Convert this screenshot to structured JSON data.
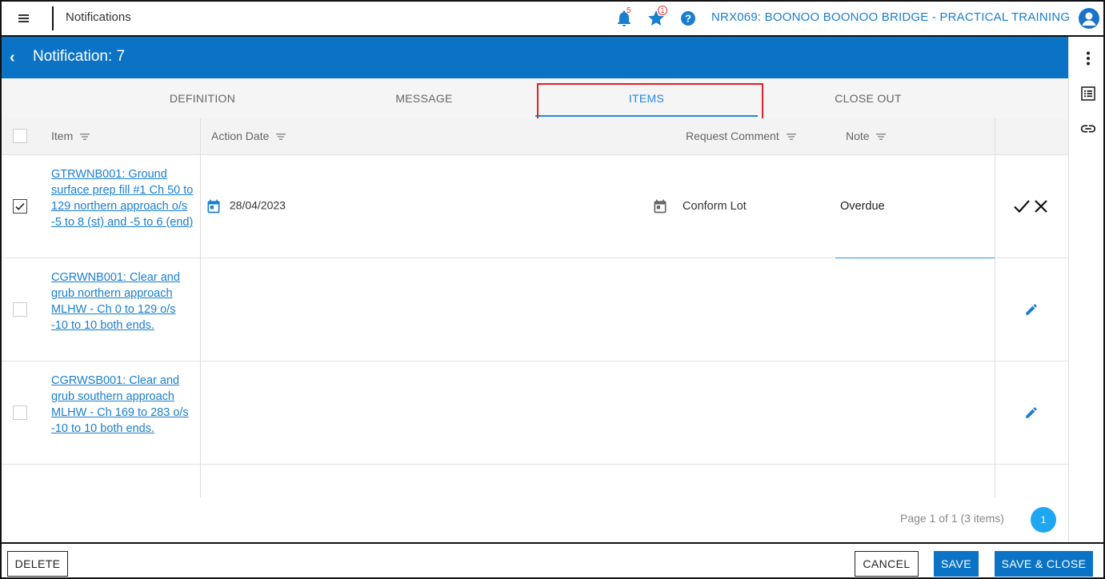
{
  "app": {
    "title": "Notifications",
    "project": "NRX069: BOONOO BOONOO BRIDGE - PRACTICAL TRAINING"
  },
  "topbar": {
    "notifications_count": "5",
    "favorites_count": "1",
    "icons": [
      "menu-icon",
      "bell-icon",
      "star-icon",
      "help-icon",
      "account-icon"
    ]
  },
  "header": {
    "title": "Notification: 7"
  },
  "tabs": [
    {
      "label": "DEFINITION"
    },
    {
      "label": "MESSAGE"
    },
    {
      "label": "ITEMS",
      "active": true
    },
    {
      "label": "CLOSE OUT"
    }
  ],
  "grid": {
    "columns": {
      "item": "Item",
      "action_date": "Action Date",
      "request_comment": "Request Comment",
      "note": "Note"
    },
    "rows": [
      {
        "item": "GTRWNB001: Ground surface prep fill #1 Ch 50 to 129 northern approach o/s -5 to 8 (st) and -5 to 6 (end)",
        "checked": true,
        "action_date": "28/04/2023",
        "request_comment": "Conform Lot",
        "note": "Overdue",
        "editing": true
      },
      {
        "item": "CGRWNB001: Clear and grub northern approach MLHW - Ch 0 to 129 o/s -10 to 10 both ends.",
        "checked": false
      },
      {
        "item": "CGRWSB001: Clear and grub southern approach MLHW - Ch 169 to 283 o/s -10 to 10 both ends.",
        "checked": false
      }
    ]
  },
  "pager": {
    "summary": "Page 1 of 1 (3 items)",
    "current": "1"
  },
  "footer": {
    "delete": "DELETE",
    "cancel": "CANCEL",
    "save": "SAVE",
    "save_close": "SAVE & CLOSE"
  },
  "colors": {
    "brand": "#0a73c6",
    "link": "#1a7ed0",
    "highlight": "#e0202a",
    "badge": "#e53935"
  }
}
